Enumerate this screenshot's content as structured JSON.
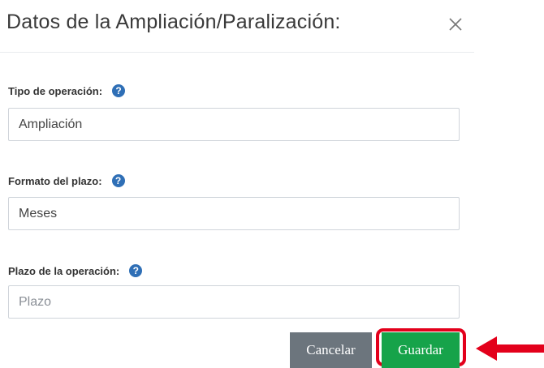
{
  "modal": {
    "title": "Datos de la Ampliación/Paralización:",
    "close_icon": "close-icon"
  },
  "form": {
    "fields": [
      {
        "label": "Tipo de operación:",
        "value": "Ampliación",
        "placeholder": "",
        "help_icon": "question-circle-icon"
      },
      {
        "label": "Formato del plazo:",
        "value": "Meses",
        "placeholder": "",
        "help_icon": "question-circle-icon"
      },
      {
        "label": "Plazo de la operación:",
        "value": "",
        "placeholder": "Plazo",
        "help_icon": "question-circle-icon"
      }
    ],
    "help_glyph": "?"
  },
  "buttons": {
    "cancel_label": "Cancelar",
    "save_label": "Guardar"
  },
  "annotation": {
    "highlight_color": "#e3001b",
    "arrow_icon": "arrow-left-icon"
  },
  "colors": {
    "save_button": "#16a34a",
    "cancel_button": "#6c757d",
    "help_icon": "#2f6fb6"
  }
}
